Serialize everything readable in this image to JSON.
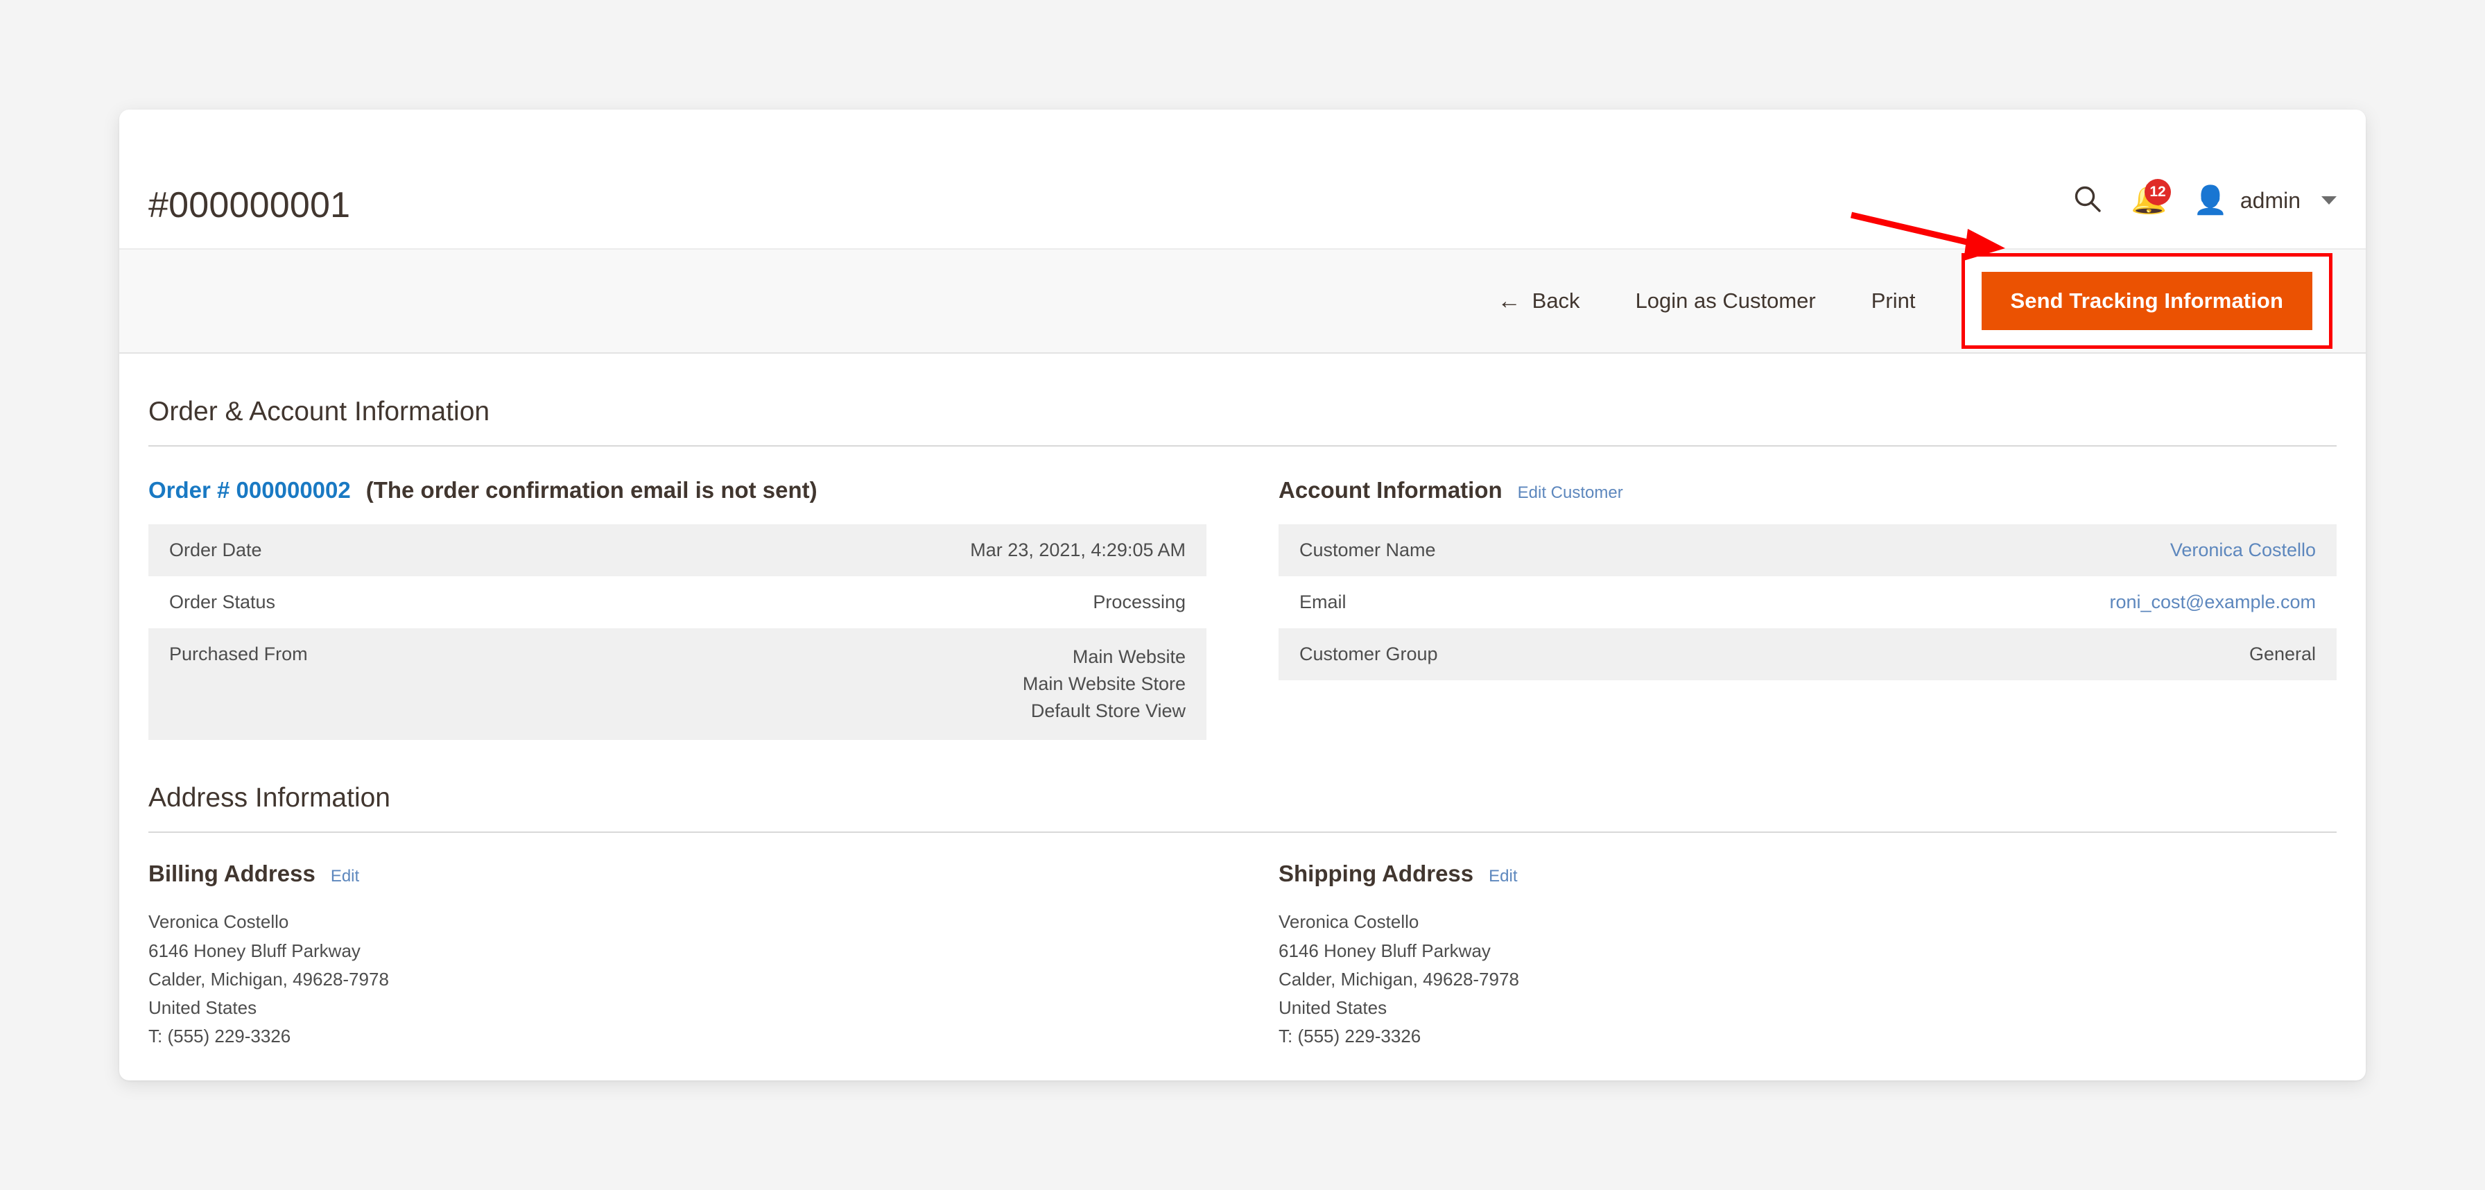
{
  "header": {
    "page_title": "#000000001",
    "search_icon": "search-icon",
    "bell_icon": "bell-icon",
    "notification_count": "12",
    "user_icon": "user-icon",
    "user_name": "admin",
    "caret_icon": "chevron-down-icon"
  },
  "page_actions": {
    "back_arrow": "←",
    "back_label": "Back",
    "login_as_customer_label": "Login as Customer",
    "print_label": "Print",
    "send_tracking_label": "Send Tracking Information"
  },
  "order_account_section": {
    "section_title": "Order & Account Information",
    "order": {
      "title": "Order # 000000002",
      "note": "(The order confirmation email is not sent)",
      "rows": [
        {
          "label": "Order Date",
          "value": "Mar 23, 2021, 4:29:05 AM"
        },
        {
          "label": "Order Status",
          "value": "Processing"
        },
        {
          "label": "Purchased From",
          "value_lines": [
            "Main Website",
            "Main Website Store",
            "Default Store View"
          ]
        }
      ]
    },
    "account": {
      "title": "Account Information",
      "edit_label": "Edit Customer",
      "rows": [
        {
          "label": "Customer Name",
          "value": "Veronica Costello",
          "is_link": true
        },
        {
          "label": "Email",
          "value": "roni_cost@example.com",
          "is_link": true
        },
        {
          "label": "Customer Group",
          "value": "General",
          "is_link": false
        }
      ]
    }
  },
  "address_section": {
    "section_title": "Address Information",
    "billing": {
      "title": "Billing Address",
      "edit_label": "Edit",
      "lines": [
        "Veronica Costello",
        "6146 Honey Bluff Parkway",
        "Calder, Michigan, 49628-7978",
        "United States",
        "T: (555) 229-3326"
      ]
    },
    "shipping": {
      "title": "Shipping Address",
      "edit_label": "Edit",
      "lines": [
        "Veronica Costello",
        "6146 Honey Bluff Parkway",
        "Calder, Michigan, 49628-7978",
        "United States",
        "T: (555) 229-3326"
      ]
    }
  },
  "annotation": {
    "arrow_color": "#fc0000",
    "highlight_color": "#fc0000",
    "highlight_target": "send-tracking-information-button"
  },
  "colors": {
    "page_background": "#f4f4f4",
    "card_background": "#ffffff",
    "primary_button": "#eb5202",
    "link_blue": "#1979c3",
    "soft_link_blue": "#5d87bd",
    "text_dark": "#41362f",
    "text_body": "#4d4d4d",
    "row_stripe": "#f0f0f0",
    "toolbar_background": "#f8f8f8",
    "badge_red": "#e02b27"
  }
}
